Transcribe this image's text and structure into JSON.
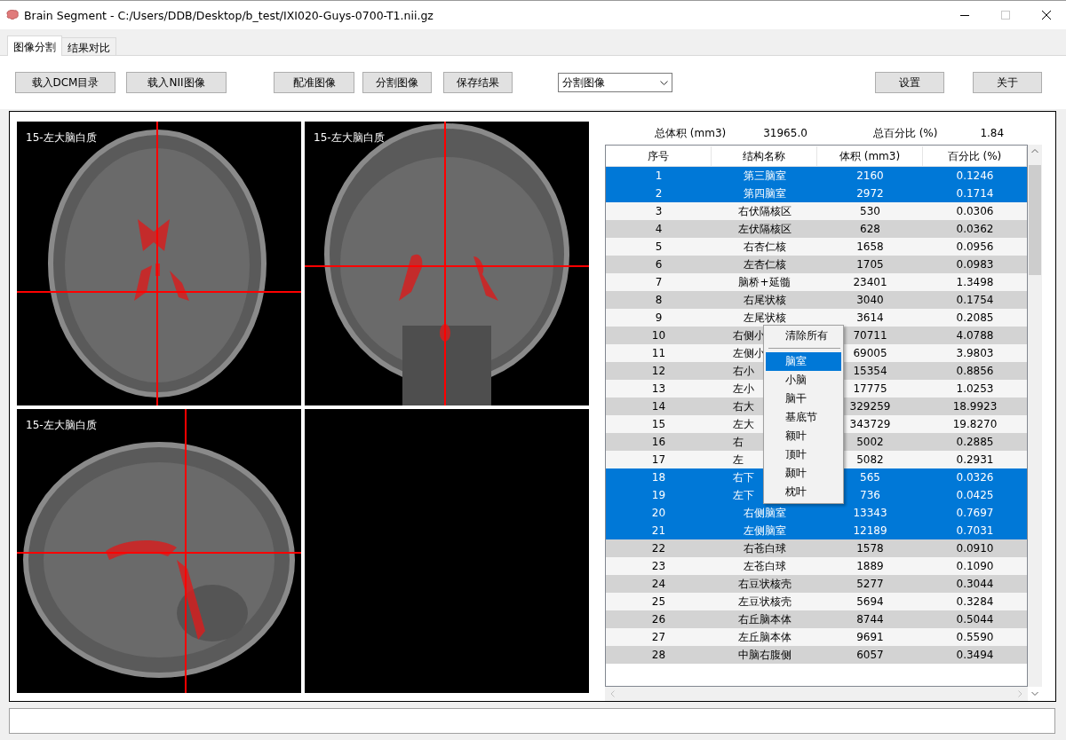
{
  "window": {
    "title": "Brain Segment - C:/Users/DDB/Desktop/b_test/IXI020-Guys-0700-T1.nii.gz"
  },
  "tabs": [
    {
      "label": "图像分割",
      "selected": true
    },
    {
      "label": "结果对比",
      "selected": false
    }
  ],
  "toolbar": {
    "buttons": [
      "载入DCM目录",
      "载入NII图像",
      "配准图像",
      "分割图像",
      "保存结果"
    ],
    "dropdown": {
      "value": "分割图像"
    },
    "right_buttons": [
      "设置",
      "关于"
    ]
  },
  "views": [
    {
      "kind": "axial",
      "label": "15-左大脑白质"
    },
    {
      "kind": "coronal",
      "label": "15-左大脑白质"
    },
    {
      "kind": "sagittal",
      "label": "15-左大脑白质"
    },
    {
      "kind": "empty"
    }
  ],
  "summary": {
    "total_volume_label": "总体积 (mm3)",
    "total_volume": "31965.0",
    "total_percent_label": "总百分比 (%)",
    "total_percent": "1.84"
  },
  "table": {
    "columns": [
      "序号",
      "结构名称",
      "体积 (mm3)",
      "百分比 (%)"
    ],
    "rows": [
      {
        "index": "1",
        "name": "第三脑室",
        "volume": "2160",
        "percent": "0.1246",
        "selected": true,
        "kind": "full"
      },
      {
        "index": "2",
        "name": "第四脑室",
        "volume": "2972",
        "percent": "0.1714",
        "selected": true,
        "kind": "full"
      },
      {
        "index": "3",
        "name": "右伏隔核区",
        "volume": "530",
        "percent": "0.0306",
        "selected": false,
        "kind": "full"
      },
      {
        "index": "4",
        "name": "左伏隔核区",
        "volume": "628",
        "percent": "0.0362",
        "selected": false,
        "kind": "full"
      },
      {
        "index": "5",
        "name": "右杏仁核",
        "volume": "1658",
        "percent": "0.0956",
        "selected": false,
        "kind": "full"
      },
      {
        "index": "6",
        "name": "左杏仁核",
        "volume": "1705",
        "percent": "0.0983",
        "selected": false,
        "kind": "full"
      },
      {
        "index": "7",
        "name": "脑桥+延髓",
        "volume": "23401",
        "percent": "1.3498",
        "selected": false,
        "kind": "full"
      },
      {
        "index": "8",
        "name": "右尾状核",
        "volume": "3040",
        "percent": "0.1754",
        "selected": false,
        "kind": "full"
      },
      {
        "index": "9",
        "name": "左尾状核",
        "volume": "3614",
        "percent": "0.2085",
        "selected": false,
        "kind": "full"
      },
      {
        "index": "10",
        "name": "右侧小",
        "volume": "70711",
        "percent": "4.0788",
        "selected": false,
        "kind": "covered"
      },
      {
        "index": "11",
        "name": "左侧小",
        "volume": "69005",
        "percent": "3.9803",
        "selected": false,
        "kind": "covered"
      },
      {
        "index": "12",
        "name": "右小",
        "volume": "15354",
        "percent": "0.8856",
        "selected": false,
        "kind": "covered"
      },
      {
        "index": "13",
        "name": "左小",
        "volume": "17775",
        "percent": "1.0253",
        "selected": false,
        "kind": "covered"
      },
      {
        "index": "14",
        "name": "右大",
        "volume": "329259",
        "percent": "18.9923",
        "selected": false,
        "kind": "covered"
      },
      {
        "index": "15",
        "name": "左大",
        "volume": "343729",
        "percent": "19.8270",
        "selected": false,
        "kind": "covered"
      },
      {
        "index": "16",
        "name": "右",
        "volume": "5002",
        "percent": "0.2885",
        "selected": false,
        "kind": "covered"
      },
      {
        "index": "17",
        "name": "左",
        "volume": "5082",
        "percent": "0.2931",
        "selected": false,
        "kind": "covered"
      },
      {
        "index": "18",
        "name": "右下",
        "volume": "565",
        "percent": "0.0326",
        "selected": true,
        "kind": "covered"
      },
      {
        "index": "19",
        "name": "左下",
        "volume": "736",
        "percent": "0.0425",
        "selected": true,
        "kind": "covered"
      },
      {
        "index": "20",
        "name": "右侧脑室",
        "volume": "13343",
        "percent": "0.7697",
        "selected": true,
        "kind": "full"
      },
      {
        "index": "21",
        "name": "左侧脑室",
        "volume": "12189",
        "percent": "0.7031",
        "selected": true,
        "kind": "full"
      },
      {
        "index": "22",
        "name": "右苍白球",
        "volume": "1578",
        "percent": "0.0910",
        "selected": false,
        "kind": "full"
      },
      {
        "index": "23",
        "name": "左苍白球",
        "volume": "1889",
        "percent": "0.1090",
        "selected": false,
        "kind": "full"
      },
      {
        "index": "24",
        "name": "右豆状核壳",
        "volume": "5277",
        "percent": "0.3044",
        "selected": false,
        "kind": "full"
      },
      {
        "index": "25",
        "name": "左豆状核壳",
        "volume": "5694",
        "percent": "0.3284",
        "selected": false,
        "kind": "full"
      },
      {
        "index": "26",
        "name": "右丘脑本体",
        "volume": "8744",
        "percent": "0.5044",
        "selected": false,
        "kind": "full"
      },
      {
        "index": "27",
        "name": "左丘脑本体",
        "volume": "9691",
        "percent": "0.5590",
        "selected": false,
        "kind": "full"
      },
      {
        "index": "28",
        "name": "中脑右腹侧",
        "volume": "6057",
        "percent": "0.3494",
        "selected": false,
        "kind": "full"
      }
    ]
  },
  "context_menu": {
    "items": [
      {
        "kind": "command",
        "label": "清除所有",
        "selected": false
      },
      {
        "kind": "separator"
      },
      {
        "kind": "command",
        "label": "脑室",
        "selected": true
      },
      {
        "kind": "command",
        "label": "小脑",
        "selected": false
      },
      {
        "kind": "command",
        "label": "脑干",
        "selected": false
      },
      {
        "kind": "command",
        "label": "基底节",
        "selected": false
      },
      {
        "kind": "command",
        "label": "额叶",
        "selected": false
      },
      {
        "kind": "command",
        "label": "顶叶",
        "selected": false
      },
      {
        "kind": "command",
        "label": "颞叶",
        "selected": false
      },
      {
        "kind": "command",
        "label": "枕叶",
        "selected": false
      }
    ]
  }
}
